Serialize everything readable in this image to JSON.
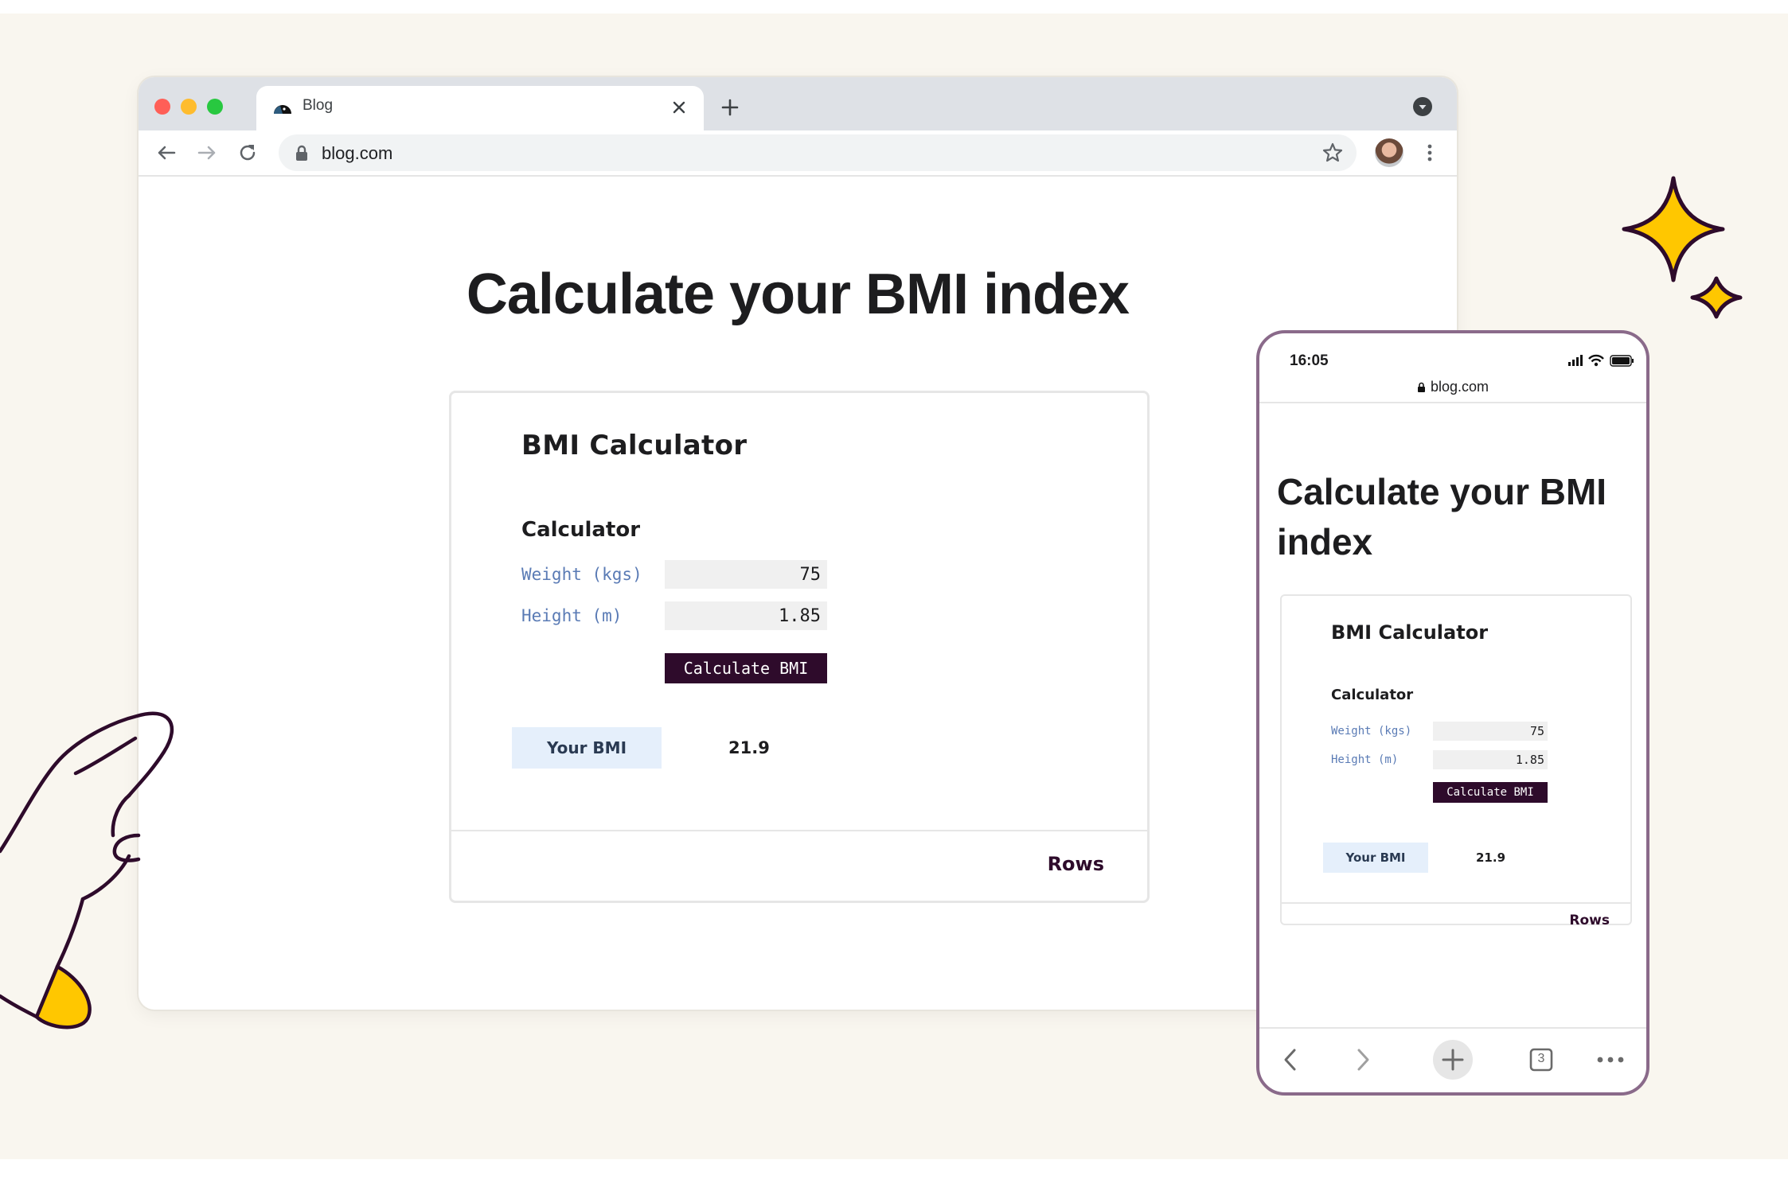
{
  "desktop": {
    "tab": {
      "title": "Blog"
    },
    "address_bar": {
      "url": "blog.com"
    },
    "page": {
      "heading": "Calculate your BMI index",
      "card": {
        "title": "BMI Calculator",
        "section": "Calculator",
        "weight_label": "Weight (kgs)",
        "weight_value": "75",
        "height_label": "Height (m)",
        "height_value": "1.85",
        "button_label": "Calculate BMI",
        "result_label": "Your BMI",
        "result_value": "21.9",
        "footer_link": "Rows"
      }
    }
  },
  "mobile": {
    "status_time": "16:05",
    "address": "blog.com",
    "page": {
      "heading": "Calculate your BMI index",
      "card": {
        "title": "BMI Calculator",
        "section": "Calculator",
        "weight_label": "Weight (kgs)",
        "weight_value": "75",
        "height_label": "Height (m)",
        "height_value": "1.85",
        "button_label": "Calculate BMI",
        "result_label": "Your BMI",
        "result_value": "21.9",
        "footer_link": "Rows"
      }
    },
    "tab_count": "3"
  },
  "icons": {
    "back": "arrow-left-icon",
    "forward": "arrow-right-icon",
    "reload": "reload-icon",
    "lock": "lock-icon",
    "bookmark": "star-icon",
    "menu": "kebab-menu-icon",
    "new_tab": "plus-icon",
    "close_tab": "close-icon"
  },
  "colors": {
    "background": "#f9f6ef",
    "accent_dark": "#2e0b2b",
    "label_blue": "#5a7bb5",
    "result_bg": "#e5effb",
    "sparkle_yellow": "#ffc700",
    "phone_frame": "#8a6a8a"
  }
}
